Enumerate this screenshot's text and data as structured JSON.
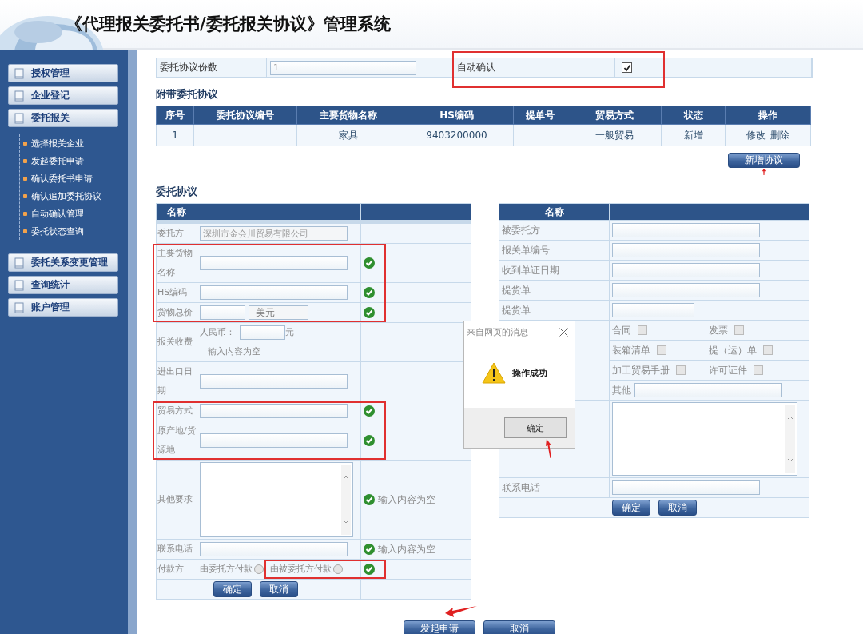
{
  "header": {
    "title": "《代理报关委托书/委托报关协议》管理系统"
  },
  "sidebar": {
    "menus": [
      {
        "label": "授权管理"
      },
      {
        "label": "企业登记"
      },
      {
        "label": "委托报关",
        "children": [
          "选择报关企业",
          "发起委托申请",
          "确认委托书申请",
          "确认追加委托协议",
          "自动确认管理",
          "委托状态查询"
        ]
      },
      {
        "label": "委托关系变更管理"
      },
      {
        "label": "查询统计"
      },
      {
        "label": "账户管理"
      }
    ]
  },
  "summary": {
    "label": "委托协议份数",
    "value": "1",
    "auto_confirm": {
      "label": "自动确认",
      "checked": true,
      "highlighted": true
    }
  },
  "attached": {
    "title": "附带委托协议",
    "columns": [
      "序号",
      "委托协议编号",
      "主要货物名称",
      "HS编码",
      "提单号",
      "贸易方式",
      "状态",
      "操作"
    ],
    "rows": [
      {
        "cells": [
          "1",
          null,
          "家具",
          "9403200000",
          null,
          "一般贸易",
          "新增"
        ],
        "actions": [
          "修改",
          "删除"
        ]
      }
    ],
    "add_button": "新增协议"
  },
  "agreement": {
    "title": "委托协议",
    "left": {
      "header": "名称",
      "rows": [
        {
          "kind": "input",
          "label": "委托方",
          "value": "深圳市金会川贸易有限公司",
          "valid": false,
          "highlighted": false
        },
        {
          "kind": "input",
          "label": "主要货物名称",
          "valid": true,
          "highlighted": true
        },
        {
          "kind": "input",
          "label": "HS编码",
          "valid": true,
          "highlighted": true
        },
        {
          "kind": "price",
          "label": "货物总价",
          "currency": "美元",
          "valid": true,
          "highlighted": true
        },
        {
          "kind": "fee",
          "label": "报关收费",
          "prefix": "人民币：",
          "unit": "元",
          "message": "输入内容为空",
          "valid": false,
          "highlighted": false
        },
        {
          "kind": "input",
          "label": "进出口日期",
          "valid": false,
          "highlighted": false
        },
        {
          "kind": "input",
          "label": "贸易方式",
          "valid": true,
          "highlighted": true
        },
        {
          "kind": "input",
          "label": "原产地/货源地",
          "valid": true,
          "highlighted": true
        },
        {
          "kind": "textarea",
          "label": "其他要求",
          "valid": true,
          "message": "输入内容为空",
          "highlighted": false
        },
        {
          "kind": "input",
          "label": "联系电话",
          "valid": true,
          "message": "输入内容为空",
          "highlighted": false
        },
        {
          "kind": "radio",
          "label": "付款方",
          "options": [
            {
              "label": "由委托方付款",
              "selected": false
            },
            {
              "label": "由被委托方付款",
              "selected": false
            }
          ],
          "valid": true,
          "highlighted": true
        }
      ],
      "buttons": [
        "确定",
        "取消"
      ]
    },
    "right": {
      "header": "名称",
      "rows": [
        {
          "kind": "input",
          "label": "被委托方"
        },
        {
          "kind": "input",
          "label": "报关单编号"
        },
        {
          "kind": "input",
          "label": "收到单证日期"
        },
        {
          "kind": "input",
          "label": "提货单"
        },
        {
          "kind": "short",
          "label": "提货单"
        }
      ],
      "documents": [
        {
          "label": "合同",
          "checked": false
        },
        {
          "label": "发票",
          "checked": false
        },
        {
          "label": "装箱清单",
          "checked": false
        },
        {
          "label": "提（运）单",
          "checked": false
        },
        {
          "label": "加工贸易手册",
          "checked": false
        },
        {
          "label": "许可证件",
          "checked": false
        }
      ],
      "other_label": "其他",
      "phone_label": "联系电话",
      "buttons": [
        "确定",
        "取消"
      ]
    }
  },
  "dialog": {
    "title": "来自网页的消息",
    "message": "操作成功",
    "button": "确定"
  },
  "footer_buttons": [
    "发起申请",
    "取消"
  ]
}
